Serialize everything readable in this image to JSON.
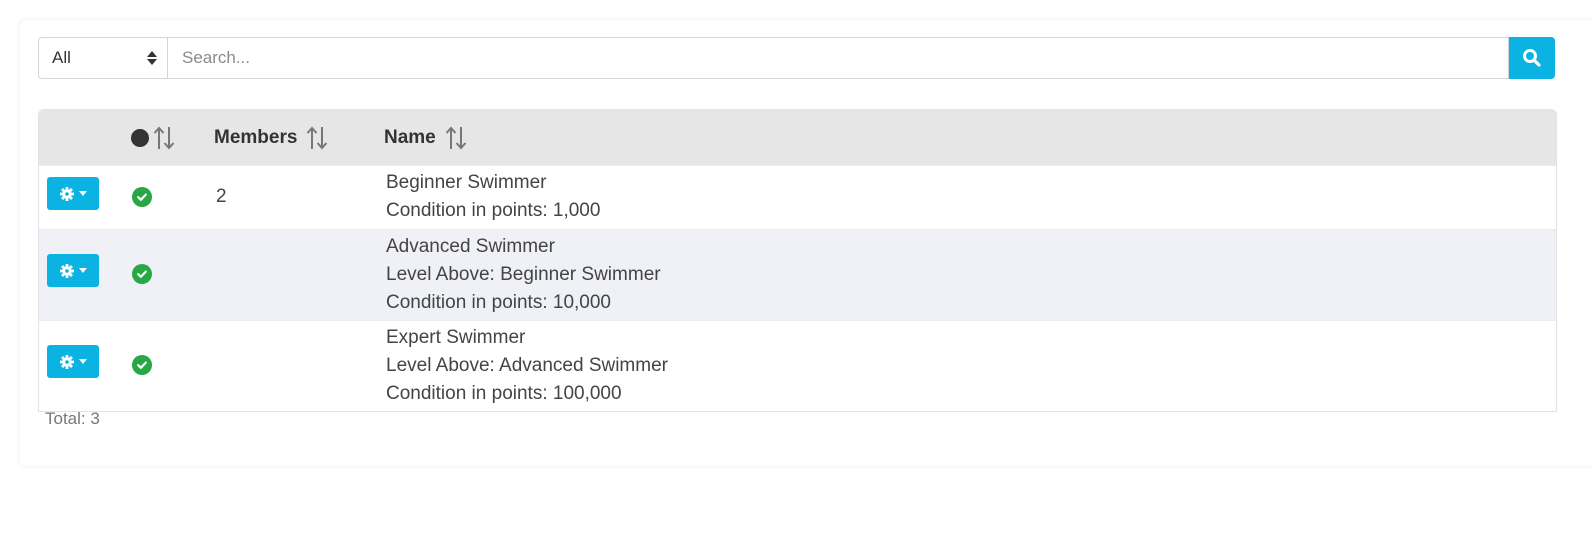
{
  "filter": {
    "selected": "All"
  },
  "search": {
    "placeholder": "Search..."
  },
  "table": {
    "headers": {
      "status_sort": "",
      "members": "Members",
      "name": "Name"
    },
    "rows": [
      {
        "members": "2",
        "name_lines": [
          "Beginner Swimmer",
          "Condition in points: 1,000"
        ]
      },
      {
        "members": "",
        "name_lines": [
          "Advanced Swimmer",
          "Level Above: Beginner Swimmer",
          "Condition in points: 10,000"
        ]
      },
      {
        "members": "",
        "name_lines": [
          "Expert Swimmer",
          "Level Above: Advanced Swimmer",
          "Condition in points: 100,000"
        ]
      }
    ]
  },
  "footer": {
    "total": "Total: 3"
  },
  "colors": {
    "accent": "#0ab3e2",
    "success": "#28a745",
    "header_bg": "#e6e6e6",
    "alt_row_bg": "#f0f1f6"
  },
  "icons": {
    "search": "search-icon",
    "gear": "gear-icon",
    "check": "check-circle-icon",
    "sort": "sort-icon",
    "status": "status-dot-icon"
  }
}
